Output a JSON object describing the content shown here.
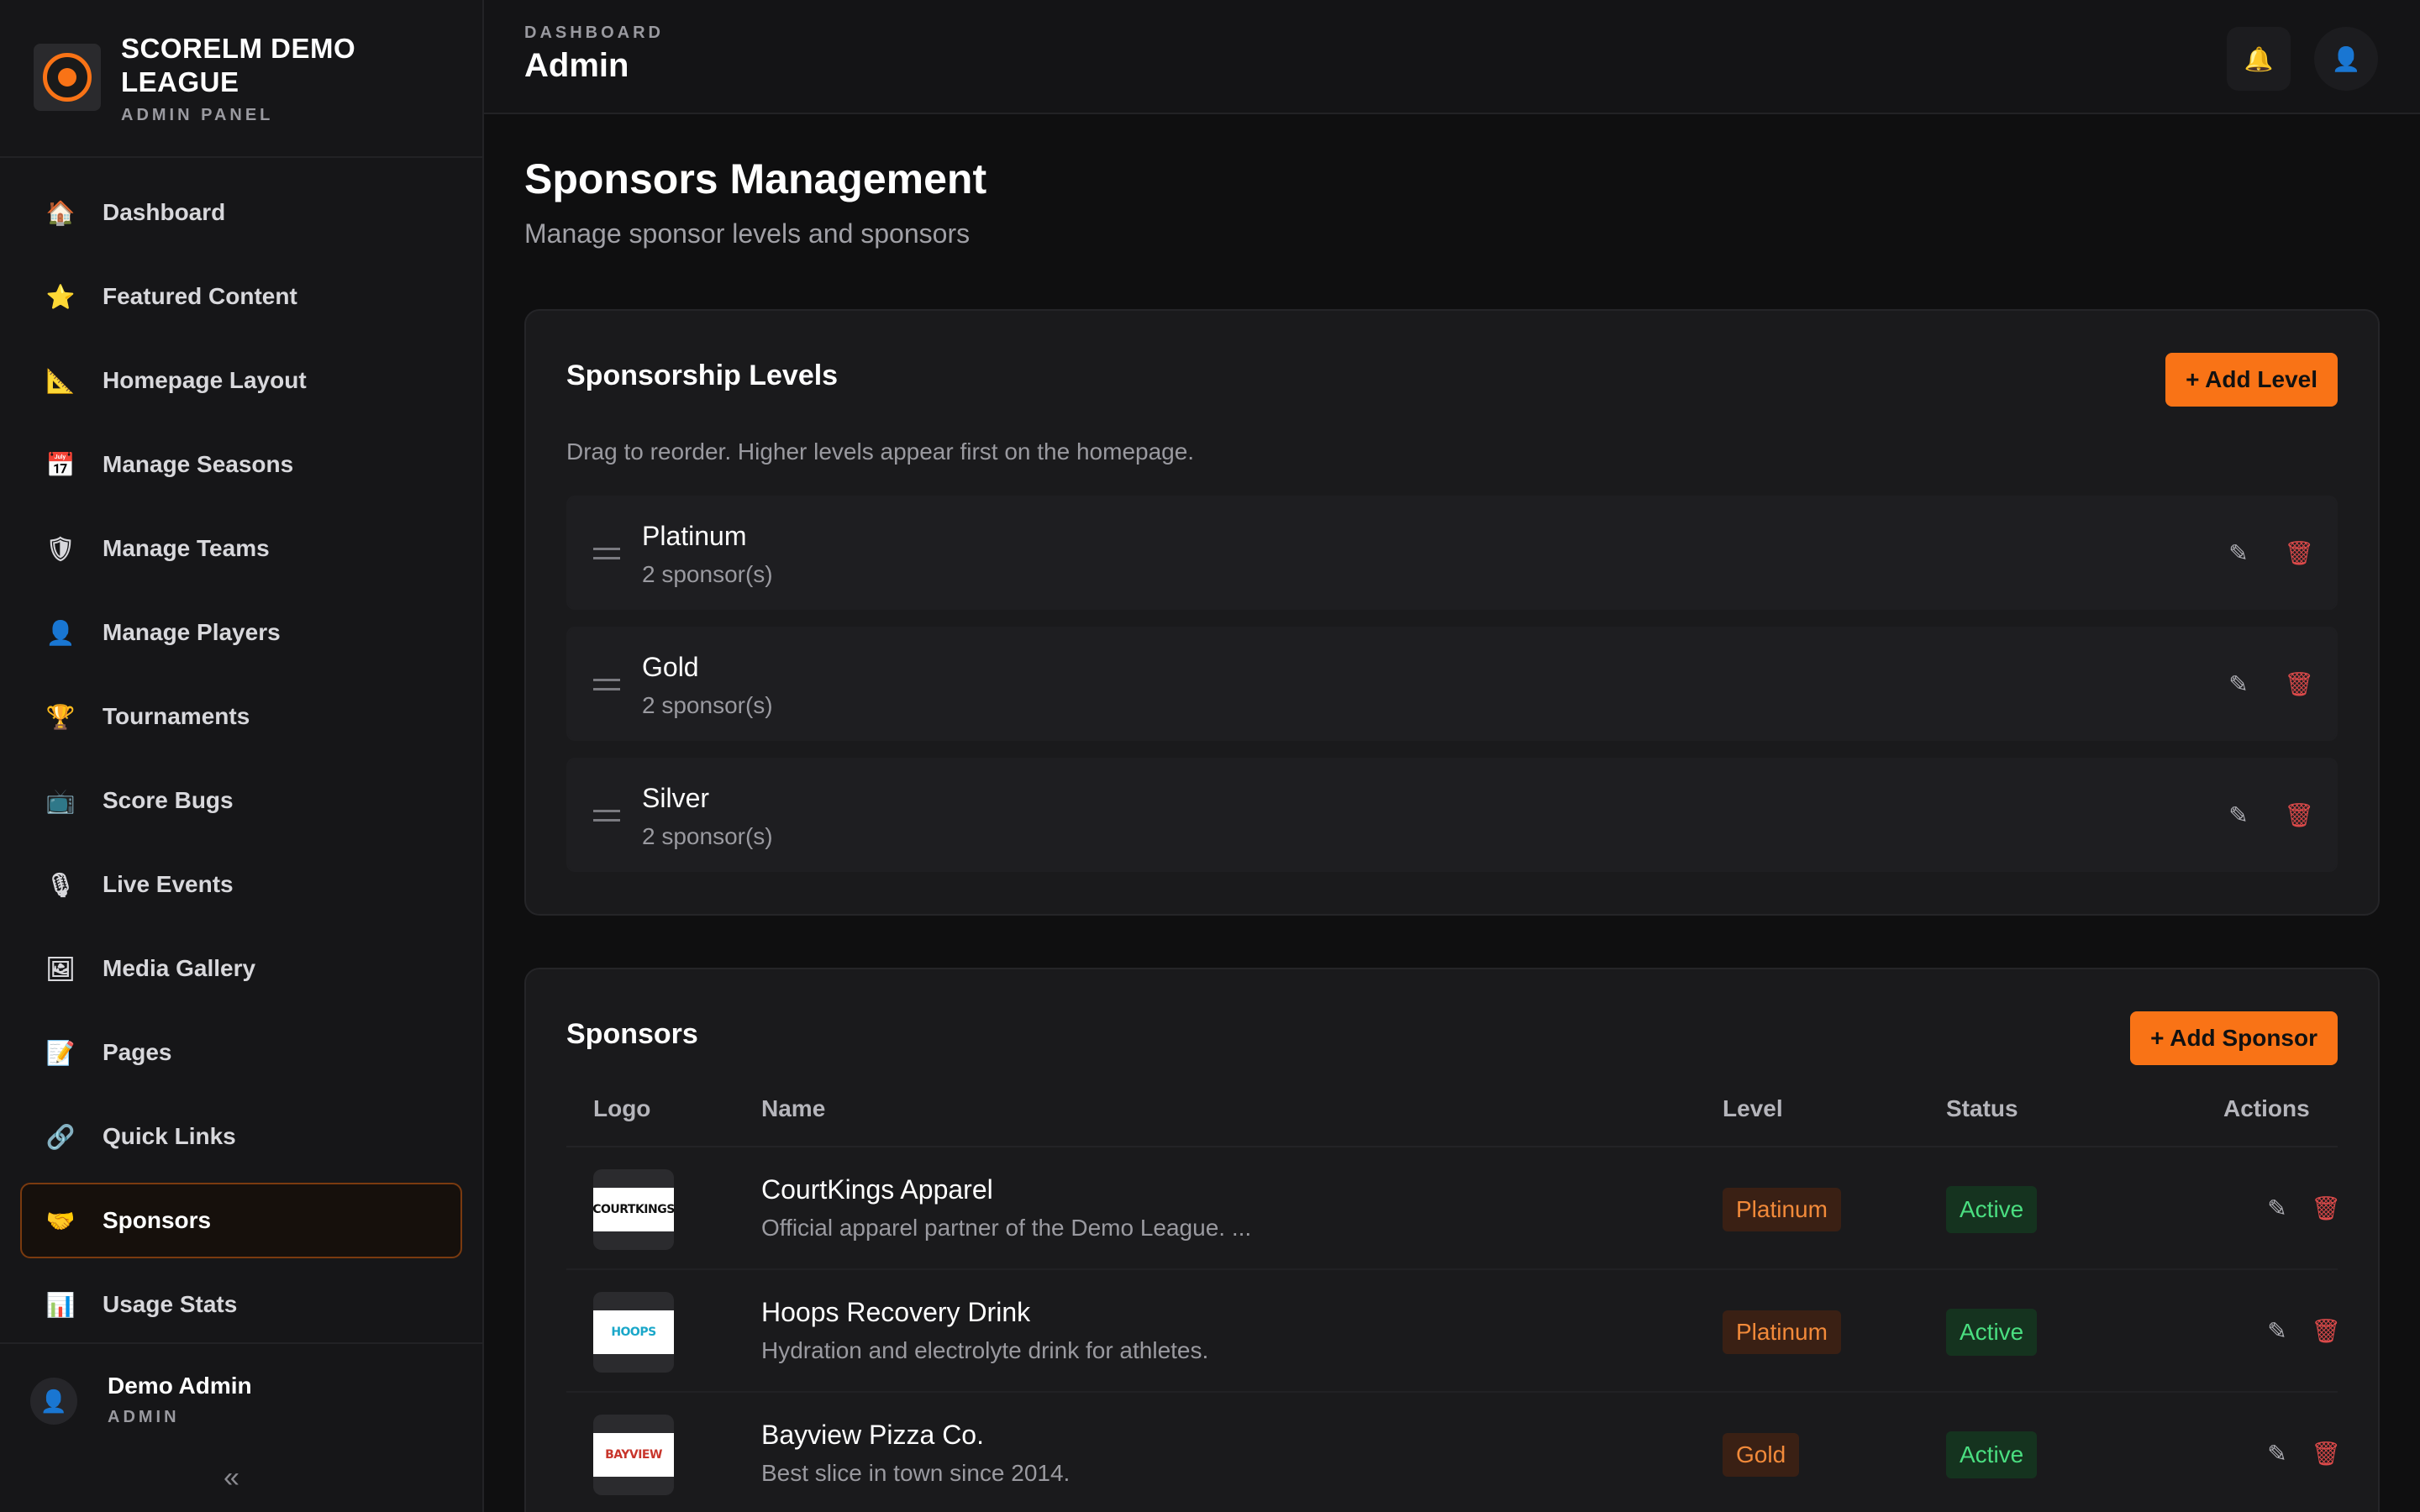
{
  "sidebar": {
    "brand_title": "SCORELM DEMO LEAGUE",
    "brand_subtitle": "ADMIN PANEL",
    "items": [
      {
        "label": "Dashboard",
        "icon": "🏠"
      },
      {
        "label": "Featured Content",
        "icon": "⭐"
      },
      {
        "label": "Homepage Layout",
        "icon": "📐"
      },
      {
        "label": "Manage Seasons",
        "icon": "📅"
      },
      {
        "label": "Manage Teams",
        "icon": "🛡"
      },
      {
        "label": "Manage Players",
        "icon": "👤"
      },
      {
        "label": "Tournaments",
        "icon": "🏆"
      },
      {
        "label": "Score Bugs",
        "icon": "📺"
      },
      {
        "label": "Live Events",
        "icon": "🎙"
      },
      {
        "label": "Media Gallery",
        "icon": "🖼"
      },
      {
        "label": "Pages",
        "icon": "📝"
      },
      {
        "label": "Quick Links",
        "icon": "🔗"
      },
      {
        "label": "Sponsors",
        "icon": "🤝"
      },
      {
        "label": "Usage Stats",
        "icon": "📊"
      }
    ],
    "active_item": "Sponsors",
    "user": {
      "name": "Demo Admin",
      "role": "ADMIN",
      "avatar_icon": "👤"
    },
    "collapse_icon": "«"
  },
  "topbar": {
    "breadcrumb": "DASHBOARD",
    "title": "Admin",
    "bell_icon": "🔔",
    "avatar_icon": "👤"
  },
  "page": {
    "title": "Sponsors Management",
    "subtitle": "Manage sponsor levels and sponsors"
  },
  "levels_card": {
    "title": "Sponsorship Levels",
    "add_button": "+ Add Level",
    "hint": "Drag to reorder. Higher levels appear first on the homepage.",
    "levels": [
      {
        "name": "Platinum",
        "count": "2 sponsor(s)"
      },
      {
        "name": "Gold",
        "count": "2 sponsor(s)"
      },
      {
        "name": "Silver",
        "count": "2 sponsor(s)"
      }
    ]
  },
  "sponsors_card": {
    "title": "Sponsors",
    "add_button": "+ Add Sponsor",
    "columns": {
      "logo": "Logo",
      "name": "Name",
      "level": "Level",
      "status": "Status",
      "actions": "Actions"
    },
    "rows": [
      {
        "name": "CourtKings Apparel",
        "description": "Official apparel partner of the Demo League. ...",
        "level": "Platinum",
        "status": "Active",
        "logo_text": "COURTKINGS"
      },
      {
        "name": "Hoops Recovery Drink",
        "description": "Hydration and electrolyte drink for athletes.",
        "level": "Platinum",
        "status": "Active",
        "logo_text": "HOOPS"
      },
      {
        "name": "Bayview Pizza Co.",
        "description": "Best slice in town since 2014.",
        "level": "Gold",
        "status": "Active",
        "logo_text": "BAYVIEW"
      }
    ]
  },
  "icons": {
    "edit": "✎",
    "delete": "🗑",
    "drag": "drag-handle-icon"
  },
  "colors": {
    "accent": "#f97316",
    "active_green": "#4ade80",
    "danger": "#dc4a4a"
  }
}
